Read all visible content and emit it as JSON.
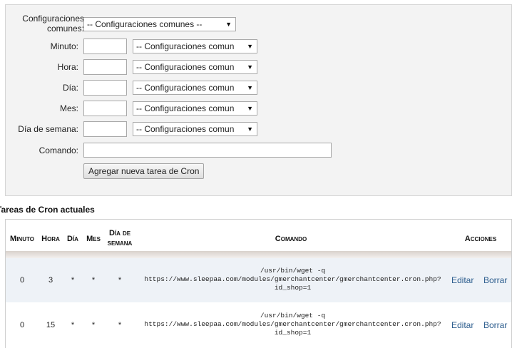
{
  "form": {
    "common_label": "Configuraciones comunes:",
    "common_select": "-- Configuraciones comunes --",
    "minute_label": "Minuto:",
    "hour_label": "Hora:",
    "day_label": "Día:",
    "month_label": "Mes:",
    "weekday_label": "Día de semana:",
    "command_label": "Comando:",
    "field_select": "-- Configuraciones comun",
    "minute_value": "",
    "hour_value": "",
    "day_value": "",
    "month_value": "",
    "weekday_value": "",
    "command_value": "",
    "submit_label": "Agregar nueva tarea de Cron"
  },
  "current": {
    "title": "Tareas de Cron actuales",
    "headers": {
      "minute": "Minuto",
      "hour": "Hora",
      "day": "Día",
      "month": "Mes",
      "weekday_line1": "Día de",
      "weekday_line2": "semana",
      "command": "Comando",
      "actions": "Acciones"
    },
    "rows": [
      {
        "minute": "0",
        "hour": "3",
        "day": "*",
        "month": "*",
        "weekday": "*",
        "cmd_line1": "/usr/bin/wget -q",
        "cmd_line2": "https://www.sleepaa.com/modules/gmerchantcenter/gmerchantcenter.cron.php?",
        "cmd_line3": "id_shop=1",
        "edit": "Editar",
        "delete": "Borrar"
      },
      {
        "minute": "0",
        "hour": "15",
        "day": "*",
        "month": "*",
        "weekday": "*",
        "cmd_line1": "/usr/bin/wget -q",
        "cmd_line2": "https://www.sleepaa.com/modules/gmerchantcenter/gmerchantcenter.cron.php?",
        "cmd_line3": "id_shop=1",
        "edit": "Editar",
        "delete": "Borrar"
      }
    ]
  },
  "colors": {
    "panel_bg": "#f3f3f3",
    "row_alt_bg": "#eef2f7",
    "link": "#2f5f8f"
  },
  "icons": {
    "select_arrow": "triangle-down-icon"
  }
}
